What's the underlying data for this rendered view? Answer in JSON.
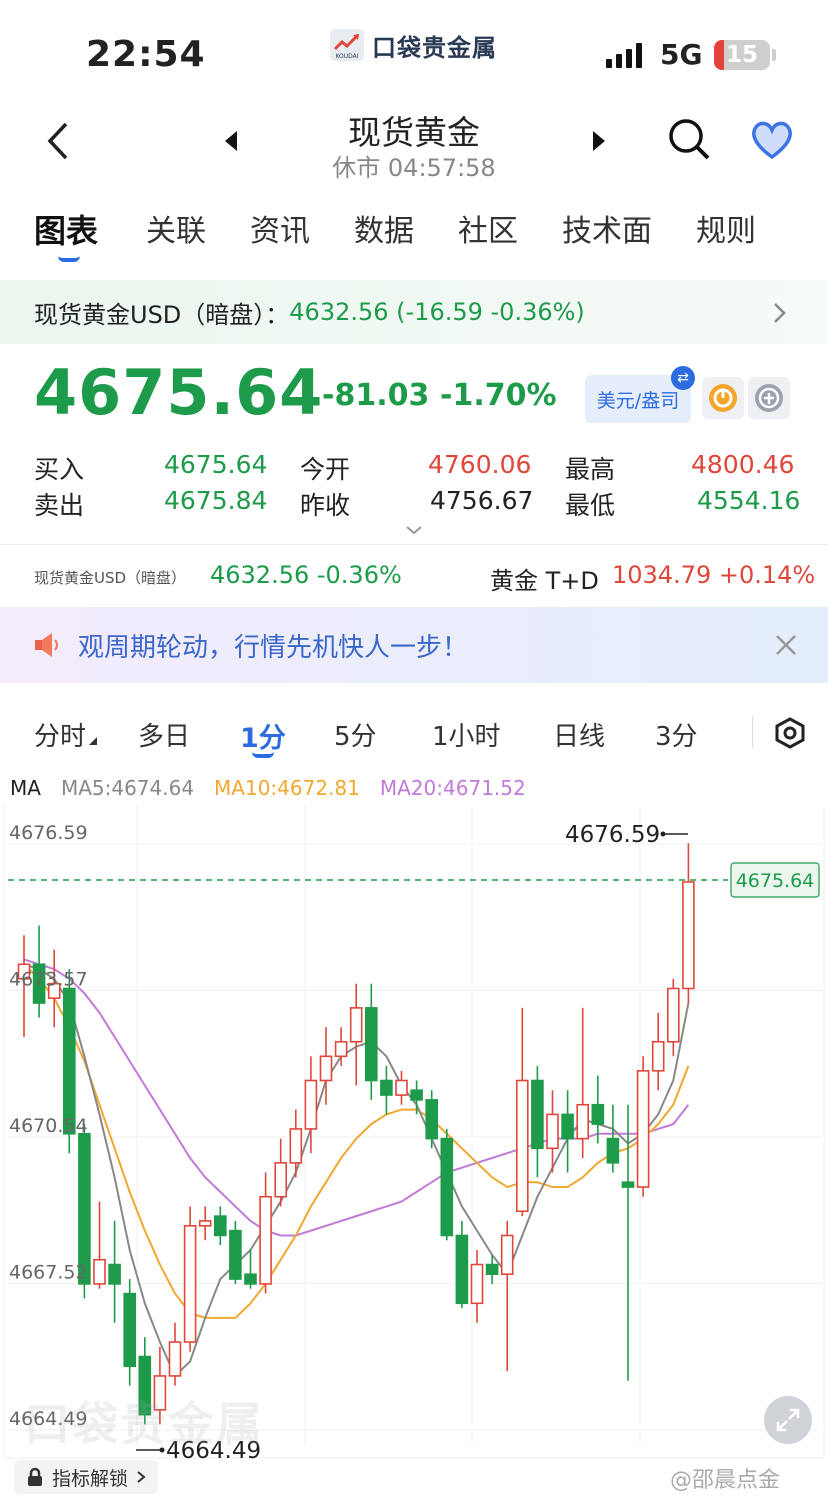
{
  "status_bar": {
    "time": "22:54",
    "network": "5G",
    "battery": "15"
  },
  "brand": {
    "name": "口袋贵金属",
    "logo_text": "KOUDAI"
  },
  "header": {
    "title": "现货黄金",
    "subtitle": "休市 04:57:58"
  },
  "tabs": [
    {
      "label": "图表",
      "active": true
    },
    {
      "label": "关联",
      "active": false
    },
    {
      "label": "资讯",
      "active": false
    },
    {
      "label": "数据",
      "active": false
    },
    {
      "label": "社区",
      "active": false
    },
    {
      "label": "技术面",
      "active": false
    },
    {
      "label": "规则",
      "active": false
    }
  ],
  "ref_bar": {
    "name": "现货黄金USD（暗盘）：",
    "value": "4632.56 (-16.59 -0.36%)"
  },
  "quote": {
    "price": "4675.64",
    "change": "-81.03",
    "change_pct": "-1.70%",
    "unit_label": "美元/盎司",
    "rows": [
      {
        "l1": "买入",
        "v1": "4675.64",
        "l2": "今开",
        "v2": "4760.06",
        "l3": "最高",
        "v3": "4800.46"
      },
      {
        "l1": "卖出",
        "v1": "4675.84",
        "l2": "昨收",
        "v2": "4756.67",
        "l3": "最低",
        "v3": "4554.16"
      }
    ]
  },
  "ticker": {
    "item1_name": "现货黄金USD（暗盘）",
    "item1_value": "4632.56 -0.36%",
    "item2_name": "黄金 T+D",
    "item2_value": "1034.79 +0.14%"
  },
  "banner": {
    "text": "观周期轮动，行情先机快人一步！"
  },
  "periods": [
    {
      "label": "分时",
      "active": false
    },
    {
      "label": "多日",
      "active": false
    },
    {
      "label": "1分",
      "active": true
    },
    {
      "label": "5分",
      "active": false
    },
    {
      "label": "1小时",
      "active": false
    },
    {
      "label": "日线",
      "active": false
    },
    {
      "label": "3分",
      "active": false
    }
  ],
  "ma": {
    "label": "MA",
    "ma5": "MA5:4674.64",
    "ma10": "MA10:4672.81",
    "ma20": "MA20:4671.52"
  },
  "chart_data": {
    "type": "candlestick",
    "y_axis_labels": [
      "4676.59",
      "4673.57",
      "4670.54",
      "4667.52",
      "4664.49"
    ],
    "ylim": [
      4664.49,
      4676.59
    ],
    "max_label": "4676.59",
    "min_label": "4664.49",
    "current_price_label": "4675.64",
    "current_price": 4675.64,
    "colors": {
      "up": "#e0473b",
      "down": "#1e9b4a",
      "ma5": "#888888",
      "ma10": "#f0a830",
      "ma20": "#c07ad8"
    },
    "candles": [
      {
        "o": 4673.6,
        "c": 4673.9,
        "h": 4674.5,
        "l": 4672.4
      },
      {
        "o": 4673.9,
        "c": 4673.1,
        "h": 4674.7,
        "l": 4672.8
      },
      {
        "o": 4673.2,
        "c": 4673.5,
        "h": 4674.2,
        "l": 4672.6
      },
      {
        "o": 4673.4,
        "c": 4670.4,
        "h": 4673.8,
        "l": 4670.0
      },
      {
        "o": 4670.4,
        "c": 4667.3,
        "h": 4670.6,
        "l": 4667.0
      },
      {
        "o": 4667.3,
        "c": 4667.8,
        "h": 4669.0,
        "l": 4667.2
      },
      {
        "o": 4667.7,
        "c": 4667.3,
        "h": 4668.6,
        "l": 4666.5
      },
      {
        "o": 4667.1,
        "c": 4665.6,
        "h": 4667.4,
        "l": 4665.2
      },
      {
        "o": 4665.8,
        "c": 4664.6,
        "h": 4666.2,
        "l": 4664.4
      },
      {
        "o": 4664.7,
        "c": 4665.4,
        "h": 4666.0,
        "l": 4664.4
      },
      {
        "o": 4665.4,
        "c": 4666.1,
        "h": 4666.5,
        "l": 4665.2
      },
      {
        "o": 4666.1,
        "c": 4668.5,
        "h": 4668.9,
        "l": 4665.9
      },
      {
        "o": 4668.5,
        "c": 4668.6,
        "h": 4668.9,
        "l": 4668.2
      },
      {
        "o": 4668.7,
        "c": 4668.3,
        "h": 4668.9,
        "l": 4668.1
      },
      {
        "o": 4668.4,
        "c": 4667.4,
        "h": 4668.6,
        "l": 4667.3
      },
      {
        "o": 4667.5,
        "c": 4667.3,
        "h": 4668.0,
        "l": 4667.2
      },
      {
        "o": 4667.3,
        "c": 4669.1,
        "h": 4669.6,
        "l": 4667.1
      },
      {
        "o": 4669.1,
        "c": 4669.8,
        "h": 4670.3,
        "l": 4668.9
      },
      {
        "o": 4669.8,
        "c": 4670.5,
        "h": 4670.9,
        "l": 4669.5
      },
      {
        "o": 4670.5,
        "c": 4671.5,
        "h": 4672.0,
        "l": 4670.0
      },
      {
        "o": 4671.5,
        "c": 4672.0,
        "h": 4672.6,
        "l": 4671.0
      },
      {
        "o": 4672.0,
        "c": 4672.3,
        "h": 4672.6,
        "l": 4671.8
      },
      {
        "o": 4672.3,
        "c": 4673.0,
        "h": 4673.5,
        "l": 4671.4
      },
      {
        "o": 4673.0,
        "c": 4671.5,
        "h": 4673.5,
        "l": 4671.1
      },
      {
        "o": 4671.5,
        "c": 4671.2,
        "h": 4671.8,
        "l": 4670.8
      },
      {
        "o": 4671.2,
        "c": 4671.5,
        "h": 4671.7,
        "l": 4671.0
      },
      {
        "o": 4671.3,
        "c": 4671.1,
        "h": 4671.5,
        "l": 4670.8
      },
      {
        "o": 4671.1,
        "c": 4670.3,
        "h": 4671.3,
        "l": 4670.1
      },
      {
        "o": 4670.3,
        "c": 4668.3,
        "h": 4670.5,
        "l": 4668.2
      },
      {
        "o": 4668.3,
        "c": 4666.9,
        "h": 4668.6,
        "l": 4666.8
      },
      {
        "o": 4666.9,
        "c": 4667.7,
        "h": 4668.0,
        "l": 4666.5
      },
      {
        "o": 4667.7,
        "c": 4667.5,
        "h": 4667.9,
        "l": 4667.3
      },
      {
        "o": 4667.5,
        "c": 4668.3,
        "h": 4668.6,
        "l": 4665.5
      },
      {
        "o": 4668.8,
        "c": 4671.5,
        "h": 4673.0,
        "l": 4668.7
      },
      {
        "o": 4671.5,
        "c": 4670.1,
        "h": 4671.8,
        "l": 4669.5
      },
      {
        "o": 4670.1,
        "c": 4670.8,
        "h": 4671.3,
        "l": 4669.6
      },
      {
        "o": 4670.8,
        "c": 4670.3,
        "h": 4671.3,
        "l": 4669.6
      },
      {
        "o": 4670.3,
        "c": 4671.0,
        "h": 4673.0,
        "l": 4669.9
      },
      {
        "o": 4671.0,
        "c": 4670.6,
        "h": 4671.6,
        "l": 4670.2
      },
      {
        "o": 4670.3,
        "c": 4669.8,
        "h": 4671.0,
        "l": 4669.6
      },
      {
        "o": 4669.4,
        "c": 4669.3,
        "h": 4671.0,
        "l": 4665.3
      },
      {
        "o": 4669.3,
        "c": 4671.7,
        "h": 4672.0,
        "l": 4669.1
      },
      {
        "o": 4671.7,
        "c": 4672.3,
        "h": 4672.9,
        "l": 4671.3
      },
      {
        "o": 4672.3,
        "c": 4673.4,
        "h": 4673.6,
        "l": 4672.0
      },
      {
        "o": 4673.4,
        "c": 4675.6,
        "h": 4676.4,
        "l": 4673.1
      }
    ],
    "ma5": [
      4673.9,
      4673.8,
      4673.6,
      4673.1,
      4672.0,
      4670.8,
      4669.5,
      4668.0,
      4666.9,
      4666.1,
      4665.4,
      4665.7,
      4666.6,
      4667.4,
      4667.7,
      4668.0,
      4668.5,
      4669.0,
      4669.6,
      4670.5,
      4671.5,
      4672.0,
      4672.2,
      4672.3,
      4672.0,
      4671.4,
      4671.0,
      4670.3,
      4669.6,
      4668.9,
      4668.4,
      4667.9,
      4667.5,
      4668.3,
      4669.1,
      4669.7,
      4670.3,
      4670.7,
      4670.6,
      4670.5,
      4670.2,
      4670.4,
      4670.8,
      4671.5,
      4673.1
    ],
    "ma10": [
      4673.9,
      4673.6,
      4673.2,
      4672.6,
      4671.9,
      4671.0,
      4670.1,
      4669.2,
      4668.4,
      4667.7,
      4667.1,
      4666.7,
      4666.6,
      4666.6,
      4666.6,
      4666.9,
      4667.3,
      4667.8,
      4668.3,
      4668.9,
      4669.4,
      4669.9,
      4670.3,
      4670.6,
      4670.8,
      4670.9,
      4670.9,
      4670.7,
      4670.4,
      4670.1,
      4669.8,
      4669.5,
      4669.3,
      4669.4,
      4669.4,
      4669.3,
      4669.3,
      4669.5,
      4669.8,
      4670.0,
      4670.1,
      4670.3,
      4670.6,
      4671.0,
      4671.8
    ],
    "ma20": [
      4674.0,
      4673.9,
      4673.8,
      4673.6,
      4673.3,
      4672.9,
      4672.4,
      4671.9,
      4671.4,
      4670.9,
      4670.4,
      4669.9,
      4669.5,
      4669.2,
      4668.9,
      4668.6,
      4668.4,
      4668.3,
      4668.3,
      4668.4,
      4668.5,
      4668.6,
      4668.7,
      4668.8,
      4668.9,
      4669.0,
      4669.2,
      4669.4,
      4669.6,
      4669.7,
      4669.8,
      4669.9,
      4670.0,
      4670.1,
      4670.2,
      4670.3,
      4670.3,
      4670.3,
      4670.4,
      4670.4,
      4670.4,
      4670.4,
      4670.5,
      4670.6,
      4671.0
    ]
  },
  "chart_footer": {
    "lock_label": "指标解锁",
    "watermark": "口袋贵金属",
    "credit": "@邵晨点金"
  }
}
